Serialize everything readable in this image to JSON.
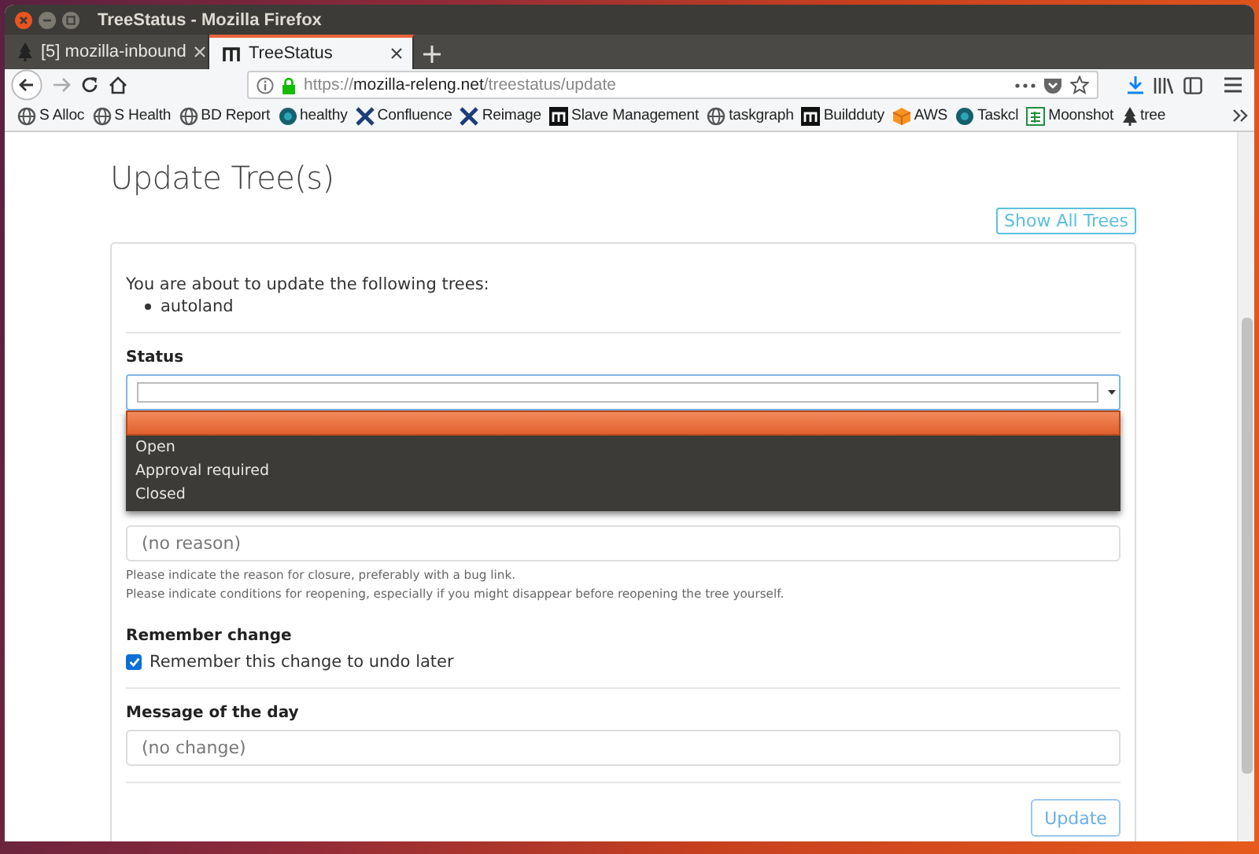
{
  "window": {
    "title": "TreeStatus - Mozilla Firefox"
  },
  "tabs": [
    {
      "label": "[5] mozilla-inbound",
      "selected": false,
      "kind": "tree"
    },
    {
      "label": "TreeStatus",
      "selected": true,
      "kind": "m"
    }
  ],
  "address_bar": {
    "scheme": "https://",
    "domain": "mozilla-releng.net",
    "path": "/treestatus/update"
  },
  "bookmarks": [
    {
      "label": "S Alloc",
      "kind": "globe"
    },
    {
      "label": "S Health",
      "kind": "globe"
    },
    {
      "label": "BD Report",
      "kind": "globe"
    },
    {
      "label": "healthy",
      "kind": "dial"
    },
    {
      "label": "Confluence",
      "kind": "cross"
    },
    {
      "label": "Reimage",
      "kind": "cross"
    },
    {
      "label": "Slave Management",
      "kind": "m"
    },
    {
      "label": "taskgraph",
      "kind": "globe"
    },
    {
      "label": "Buildduty",
      "kind": "m"
    },
    {
      "label": "AWS",
      "kind": "cube"
    },
    {
      "label": "Taskcl",
      "kind": "dial"
    },
    {
      "label": "Moonshot",
      "kind": "sheet"
    },
    {
      "label": "tree",
      "kind": "tree"
    }
  ],
  "page": {
    "title": "Update Tree(s)",
    "show_all_button": "Show All Trees",
    "intro": "You are about to update the following trees:",
    "trees": [
      "autoland"
    ],
    "status": {
      "label": "Status",
      "dropdown_open": true,
      "blank_option_highlighted": true,
      "options": [
        {
          "label": "Open",
          "selected": false
        },
        {
          "label": "Approval required",
          "selected": false
        },
        {
          "label": "Closed",
          "selected": false
        }
      ]
    },
    "reason": {
      "placeholder": "(no reason)",
      "help": [
        "Please indicate the reason for closure, preferably with a bug link.",
        "Please indicate conditions for reopening, especially if you might disappear before reopening the tree yourself."
      ]
    },
    "remember": {
      "label": "Remember change",
      "checkbox_label": "Remember this change to undo later",
      "checked": true
    },
    "motd": {
      "label": "Message of the day",
      "placeholder": "(no change)"
    },
    "submit_button": "Update"
  }
}
